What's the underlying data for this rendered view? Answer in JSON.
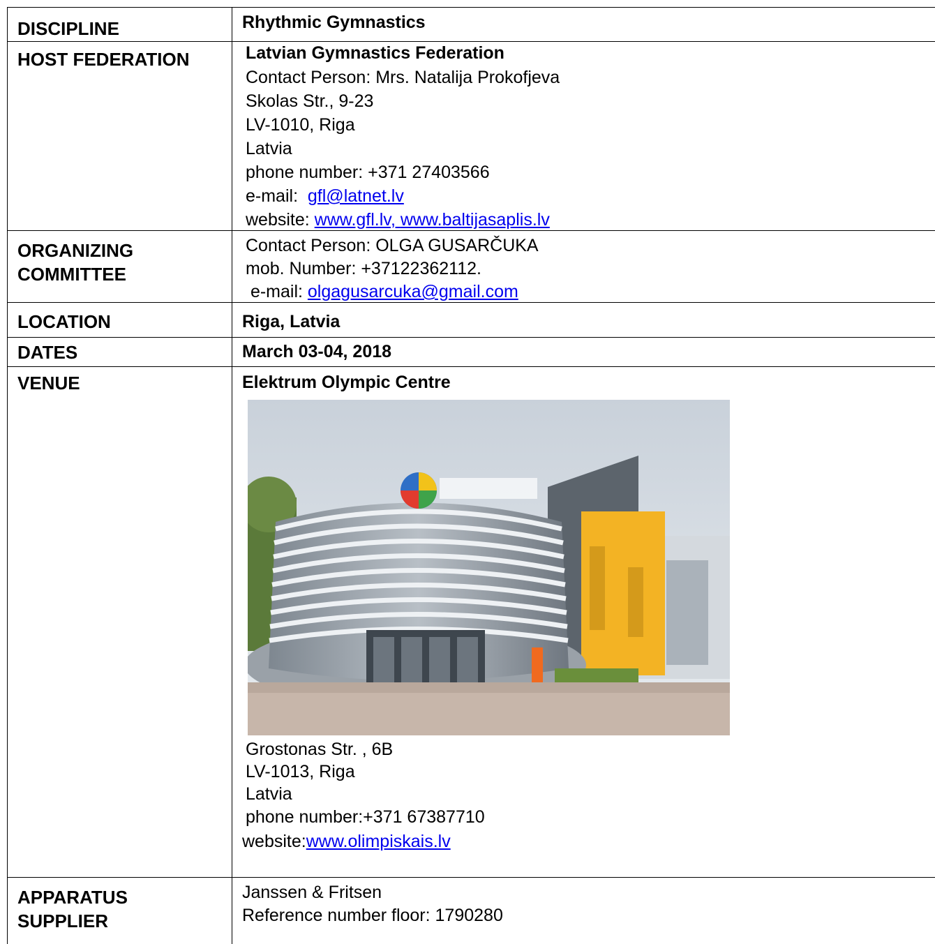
{
  "rows": {
    "discipline": {
      "label": "DISCIPLINE",
      "value": "Rhythmic Gymnastics"
    },
    "host": {
      "label": "HOST FEDERATION",
      "name": "Latvian Gymnastics Federation",
      "contact": "Contact Person:  Mrs. Natalija Prokofjeva",
      "street": "Skolas Str., 9-23",
      "city": "LV-1010, Riga",
      "country": "Latvia",
      "phone": "phone number:   +371 27403566",
      "email_label": "e-mail:  ",
      "email": "gfl@latnet.lv",
      "website_label": "website: ",
      "website1": "www.gfl.lv",
      "website_sep": ", ",
      "website2": "www.baltijasaplis.lv"
    },
    "organizing": {
      "label_line1": "ORGANIZING",
      "label_line2": "COMMITTEE",
      "contact": "Contact Person: OLGA GUSARČUKA",
      "mobile": "mob. Number:  +37122362112.",
      "email_label": " e-mail: ",
      "email": "olgagusarcuka@gmail.com"
    },
    "location": {
      "label": "LOCATION",
      "value": "Riga, Latvia"
    },
    "dates": {
      "label": "DATES",
      "value": "March 03-04, 2018"
    },
    "venue": {
      "label": "VENUE",
      "name": "Elektrum Olympic  Centre",
      "street": "Grostonas Str. , 6B",
      "city": "LV-1013, Riga",
      "country": "Latvia",
      "phone": "phone number:+371 67387710",
      "website_label": "website:",
      "website": "www.olimpiskais.lv"
    },
    "apparatus": {
      "label_line1": "APPARATUS",
      "label_line2": "SUPPLIER",
      "supplier": "Janssen & Fritsen",
      "reference": "Reference number floor: 1790280"
    }
  },
  "colors": {
    "link": "#0000ee",
    "border": "#000000"
  }
}
